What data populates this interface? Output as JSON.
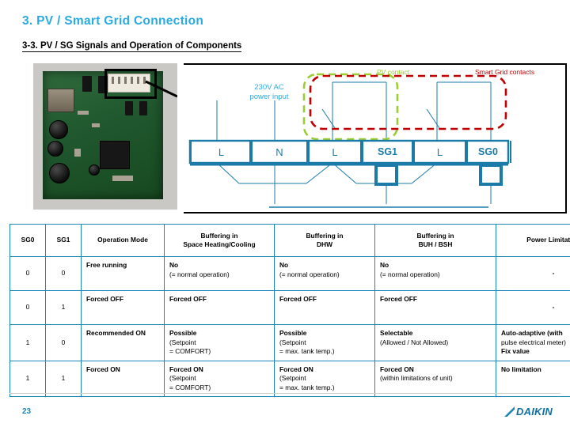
{
  "header": {
    "title": "3. PV / Smart Grid Connection",
    "subtitle": "3-3. PV / SG Signals and Operation of Components",
    "title_color": "#29ABE2"
  },
  "photo": {
    "name": "pcb-photo",
    "caption": ""
  },
  "diagram": {
    "power_label": "230V AC\npower input",
    "power_label_line1": "230V AC",
    "power_label_line2": "power input",
    "pv_contact_label": "PV contact",
    "smart_grid_label": "Smart Grid contacts",
    "pv_contact_color": "#9ACD32",
    "smart_grid_color": "#C00000",
    "terminal_color": "#1B7BA8",
    "terminals": [
      {
        "label": "L",
        "bold": false
      },
      {
        "label": "N",
        "bold": false
      },
      {
        "label": "L",
        "bold": false
      },
      {
        "label": "SG1",
        "bold": true
      },
      {
        "label": "L",
        "bold": false
      },
      {
        "label": "SG0",
        "bold": true
      }
    ]
  },
  "table": {
    "accent_color": "#1B86B8",
    "headers": [
      "SG0",
      "SG1",
      "Operation Mode",
      "Buffering in\nSpace Heating/Cooling",
      "Buffering in\nDHW",
      "Buffering in\nBUH / BSH",
      "Power Limitation"
    ],
    "headers_split": [
      {
        "l1": "SG0",
        "l2": ""
      },
      {
        "l1": "SG1",
        "l2": ""
      },
      {
        "l1": "Operation Mode",
        "l2": ""
      },
      {
        "l1": "Buffering in",
        "l2": "Space Heating/Cooling"
      },
      {
        "l1": "Buffering in",
        "l2": "DHW"
      },
      {
        "l1": "Buffering in",
        "l2": "BUH / BSH"
      },
      {
        "l1": "Power Limitation",
        "l2": ""
      }
    ],
    "rows": [
      {
        "sg0": "0",
        "sg1": "0",
        "mode": "Free running",
        "space": {
          "main": "No",
          "sub": "(= normal operation)",
          "sub2": ""
        },
        "dhw": {
          "main": "No",
          "sub": "(= normal operation)",
          "sub2": ""
        },
        "buh": {
          "main": "No",
          "sub": "(= normal operation)",
          "sub2": ""
        },
        "power": {
          "main": "-",
          "sub": "",
          "sub2": ""
        }
      },
      {
        "sg0": "0",
        "sg1": "1",
        "mode": "Forced OFF",
        "space": {
          "main": "Forced OFF",
          "sub": "",
          "sub2": ""
        },
        "dhw": {
          "main": "Forced OFF",
          "sub": "",
          "sub2": ""
        },
        "buh": {
          "main": "Forced OFF",
          "sub": "",
          "sub2": ""
        },
        "power": {
          "main": "-",
          "sub": "",
          "sub2": ""
        }
      },
      {
        "sg0": "1",
        "sg1": "0",
        "mode": "Recommended ON",
        "space": {
          "main": "Possible",
          "sub": "(Setpoint",
          "sub2": " = COMFORT)"
        },
        "dhw": {
          "main": "Possible",
          "sub": "(Setpoint",
          "sub2": " = max. tank temp.)"
        },
        "buh": {
          "main": "Selectable",
          "sub": "(Allowed / Not Allowed)",
          "sub2": ""
        },
        "power": {
          "main": "Auto-adaptive (with",
          "sub": "pulse electrical meter)",
          "sub2": "Fix value"
        }
      },
      {
        "sg0": "1",
        "sg1": "1",
        "mode": "Forced ON",
        "space": {
          "main": "Forced ON",
          "sub": "(Setpoint",
          "sub2": " = COMFORT)"
        },
        "dhw": {
          "main": "Forced ON",
          "sub": "(Setpoint",
          "sub2": " = max. tank temp.)"
        },
        "buh": {
          "main": "Forced ON",
          "sub": "(within limitations of unit)",
          "sub2": ""
        },
        "power": {
          "main": "No limitation",
          "sub": "",
          "sub2": ""
        }
      }
    ]
  },
  "footer": {
    "page_number": "23",
    "logo_text": "DAIKIN"
  }
}
